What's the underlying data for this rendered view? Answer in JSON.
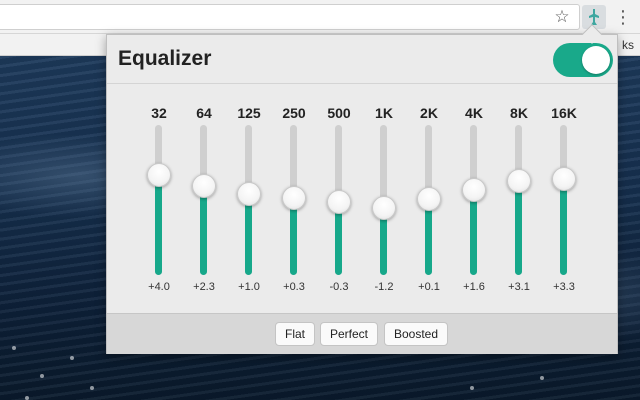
{
  "browser": {
    "bookmarks_text": "ks",
    "icons": {
      "star": "star-icon",
      "extension": "equalizer-extension-icon",
      "menu": "vertical-dots-menu-icon"
    }
  },
  "equalizer": {
    "title": "Equalizer",
    "enabled": true,
    "accent_color": "#19a98a",
    "bands": [
      {
        "label": "32",
        "value": "+4.0",
        "level": 4.0
      },
      {
        "label": "64",
        "value": "+2.3",
        "level": 2.3
      },
      {
        "label": "125",
        "value": "+1.0",
        "level": 1.0
      },
      {
        "label": "250",
        "value": "+0.3",
        "level": 0.3
      },
      {
        "label": "500",
        "value": "-0.3",
        "level": -0.3
      },
      {
        "label": "1K",
        "value": "-1.2",
        "level": -1.2
      },
      {
        "label": "2K",
        "value": "+0.1",
        "level": 0.1
      },
      {
        "label": "4K",
        "value": "+1.6",
        "level": 1.6
      },
      {
        "label": "8K",
        "value": "+3.1",
        "level": 3.1
      },
      {
        "label": "16K",
        "value": "+3.3",
        "level": 3.3
      }
    ],
    "presets": [
      "Flat",
      "Perfect",
      "Boosted"
    ]
  }
}
